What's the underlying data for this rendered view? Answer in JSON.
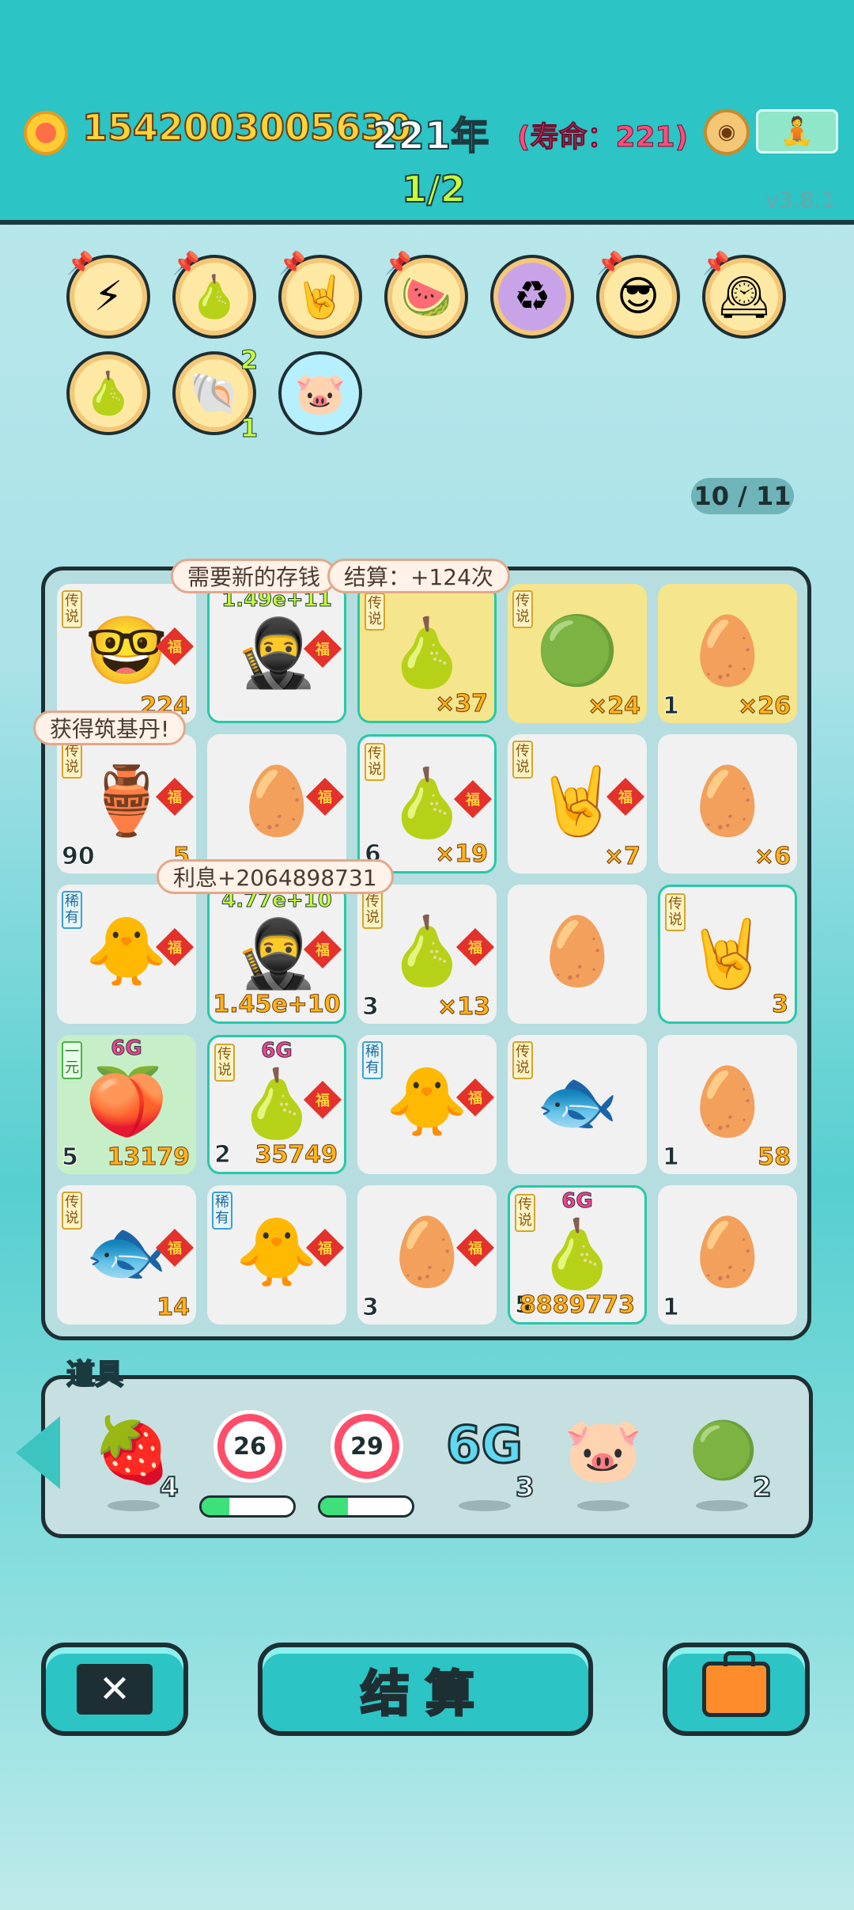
{
  "header": {
    "coins": "1542003005630",
    "year": "221年",
    "lifespan": "(寿命：221)",
    "page": "1/2",
    "version": "v3.8.1"
  },
  "relics": [
    {
      "icon": "lightning"
    },
    {
      "icon": "pomelo"
    },
    {
      "icon": "rock-hand"
    },
    {
      "icon": "fruit-basket"
    },
    {
      "icon": "recycle"
    },
    {
      "icon": "cool-face"
    },
    {
      "icon": "time-card"
    },
    {
      "icon": "pomelo"
    },
    {
      "icon": "shell",
      "count_top": "2",
      "count_bottom": "1"
    },
    {
      "icon": "piggy-bank"
    }
  ],
  "counter": "10 / 11",
  "board": {
    "bubbles": {
      "need_piggy": "需要新的存钱",
      "settle": "结算：+124次",
      "got_pill": "获得筑基丹!",
      "interest": "利息+2064898731"
    },
    "cells": [
      {
        "emoji": "🤓",
        "tag": "传说",
        "fu": "福",
        "r": "224",
        "l": ""
      },
      {
        "emoji": "🥷",
        "fu": "福",
        "top": "1.49e+11",
        "l": ""
      },
      {
        "emoji": "🍐",
        "tag": "传说",
        "r": "×37"
      },
      {
        "emoji": "🟢",
        "tag": "传说",
        "r": "×24"
      },
      {
        "emoji": "🥚",
        "l": "1",
        "r": "×26"
      },
      {
        "emoji": "🏺",
        "tag": "传说",
        "fu": "福",
        "l": "90",
        "r": "5"
      },
      {
        "emoji": "🥚",
        "fu": "福",
        "l": ""
      },
      {
        "emoji": "🍐",
        "tag": "传说",
        "fu": "福",
        "l": "6",
        "r": "×19"
      },
      {
        "emoji": "🤘",
        "tag": "传说",
        "fu": "福",
        "r": "×7"
      },
      {
        "emoji": "🥚",
        "r": "×6"
      },
      {
        "emoji": "🐥",
        "tag": "稀有",
        "fu": "福"
      },
      {
        "emoji": "🥷",
        "fu": "福",
        "top": "4.77e+10",
        "big": "1.45e+10"
      },
      {
        "emoji": "🍐",
        "tag": "传说",
        "fu": "福",
        "l": "3",
        "r": "×13"
      },
      {
        "emoji": "🥚"
      },
      {
        "emoji": "🤘",
        "tag": "传说",
        "r": "3"
      },
      {
        "emoji": "🍑",
        "tag": "一元",
        "g6": "6G",
        "l": "5",
        "r": "13179"
      },
      {
        "emoji": "🍐",
        "tag": "传说",
        "fu": "福",
        "g6": "6G",
        "l": "2",
        "r": "35749"
      },
      {
        "emoji": "🐥",
        "tag": "稀有",
        "fu": "福"
      },
      {
        "emoji": "🐟",
        "tag": "传说"
      },
      {
        "emoji": "🥚",
        "l": "1",
        "r": "58"
      },
      {
        "emoji": "🐟",
        "tag": "传说",
        "fu": "福",
        "r": "14"
      },
      {
        "emoji": "🐥",
        "tag": "稀有",
        "fu": "福"
      },
      {
        "emoji": "🥚",
        "fu": "福",
        "l": "3"
      },
      {
        "emoji": "🍐",
        "tag": "传说",
        "g6": "6G",
        "l": "5",
        "big": "8889773"
      },
      {
        "emoji": "🥚",
        "l": "1"
      }
    ]
  },
  "items": {
    "title": "道具",
    "strawberry_count": "4",
    "timer1": "26",
    "timer1_progress": 0.3,
    "timer2": "29",
    "timer2_progress": 0.3,
    "g6_label": "6G",
    "g6_count": "3",
    "orb_count": "2"
  },
  "buttons": {
    "close": "✕",
    "settle": "结算"
  }
}
